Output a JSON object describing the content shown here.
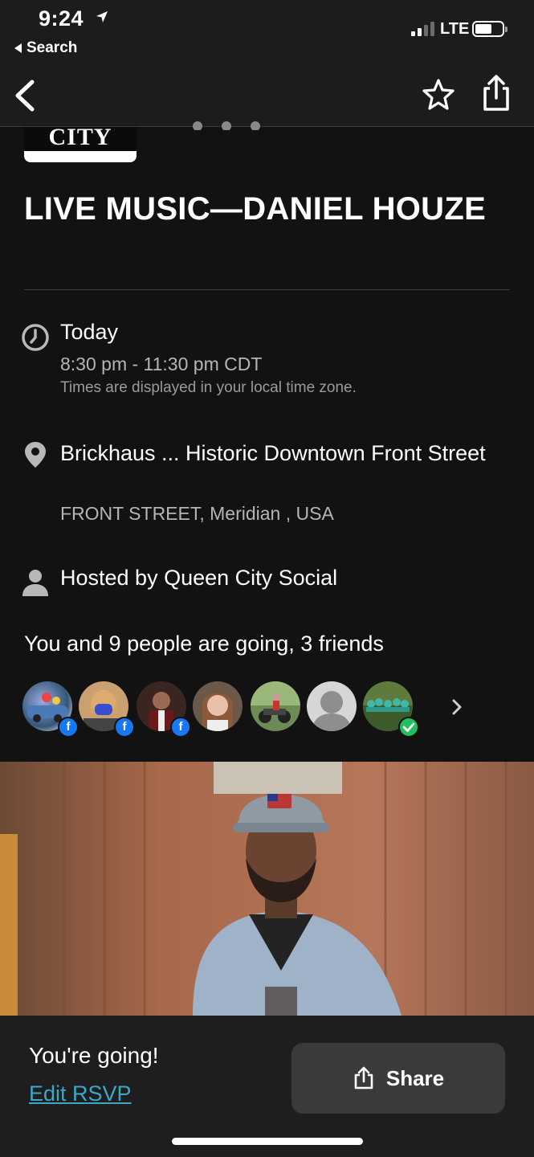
{
  "status_bar": {
    "time": "9:24",
    "back_to_app": "Search",
    "network": "LTE"
  },
  "nav": {
    "back_icon": "chevron-left-icon",
    "favorite_icon": "star-outline-icon",
    "share_icon": "share-icon"
  },
  "organizer_logo": {
    "text": "CITY"
  },
  "event": {
    "title": "LIVE MUSIC—DANIEL HOUZE",
    "date_label": "Today",
    "time_range": "8:30 pm - 11:30 pm CDT",
    "timezone_note": "Times are displayed in your local time zone.",
    "venue": "Brickhaus ... Historic Downtown Front Street",
    "address": "FRONT STREET, Meridian , USA",
    "host": "Hosted by Queen City Social"
  },
  "attendance": {
    "summary": "You and 9 people are going, 3 friends",
    "facebook_badge": "f",
    "avatars": [
      {
        "desc": "car-avatar",
        "facebook": true
      },
      {
        "desc": "masked-woman-avatar",
        "facebook": true
      },
      {
        "desc": "man-avatar",
        "facebook": true
      },
      {
        "desc": "woman-avatar",
        "facebook": false
      },
      {
        "desc": "motorcycle-avatar",
        "facebook": false
      },
      {
        "desc": "default-avatar",
        "facebook": false
      },
      {
        "desc": "group-avatar",
        "going_check": true
      }
    ]
  },
  "rsvp_bar": {
    "status": "You're going!",
    "edit_label": "Edit RSVP",
    "share_label": "Share"
  },
  "colors": {
    "background": "#121212",
    "link": "#3ba8c8",
    "facebook": "#1877f2",
    "check": "#20c060",
    "button": "#3a3a3a"
  }
}
